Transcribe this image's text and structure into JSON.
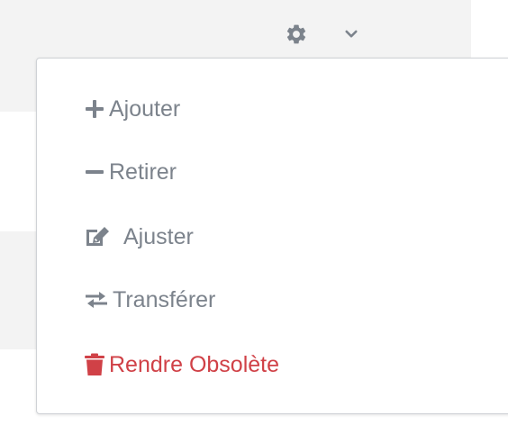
{
  "colors": {
    "text": "#7c838c",
    "danger": "#d04147",
    "icon": "#7c838c",
    "row_background": "#f3f3f3"
  },
  "toolbar": {
    "settings_icon": "gear-icon",
    "menu_toggle_icon": "chevron-down-icon"
  },
  "menu": {
    "items": [
      {
        "label": "Ajouter",
        "icon": "plus-icon"
      },
      {
        "label": "Retirer",
        "icon": "minus-icon"
      },
      {
        "label": "Ajuster",
        "icon": "edit-icon"
      },
      {
        "label": "Transférer",
        "icon": "transfer-icon"
      },
      {
        "label": "Rendre Obsolète",
        "icon": "trash-icon"
      }
    ]
  }
}
